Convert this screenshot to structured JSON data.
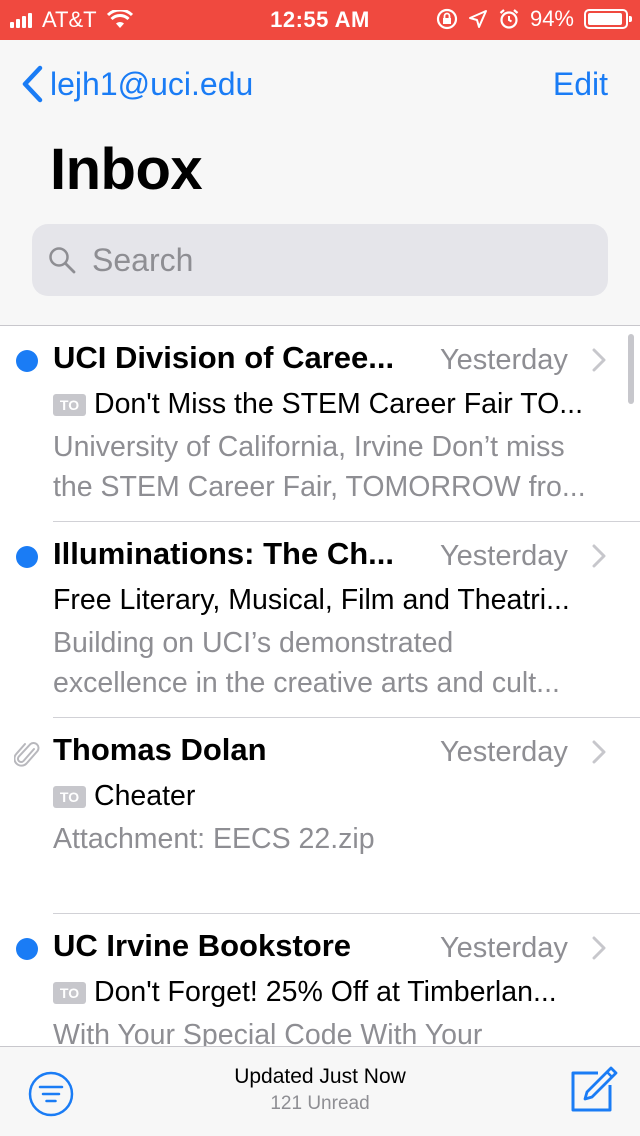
{
  "status_bar": {
    "carrier": "AT&T",
    "time": "12:55 AM",
    "battery_percent": "94%",
    "battery_level": 0.94,
    "icons": [
      "signal-bars-icon",
      "wifi-icon",
      "orientation-lock-icon",
      "location-arrow-icon",
      "alarm-clock-icon",
      "battery-icon"
    ]
  },
  "header": {
    "back_label": "lejh1@uci.edu",
    "edit_label": "Edit",
    "title": "Inbox",
    "search_placeholder": "Search"
  },
  "messages": [
    {
      "sender": "UCI Division of Caree...",
      "date": "Yesterday",
      "subject": "Don't Miss the STEM Career Fair TO...",
      "to_badge": "TO",
      "preview_line1": "University of California, Irvine Don’t miss",
      "preview_line2": "the STEM Career Fair, TOMORROW fro...",
      "unread": true,
      "attachment": false
    },
    {
      "sender": "Illuminations: The Ch...",
      "date": "Yesterday",
      "subject": "Free Literary, Musical, Film and Theatri...",
      "to_badge": "",
      "preview_line1": "Building on UCI’s demonstrated",
      "preview_line2": "excellence in the creative arts and cult...",
      "unread": true,
      "attachment": false
    },
    {
      "sender": "Thomas Dolan",
      "date": "Yesterday",
      "subject": "Cheater",
      "to_badge": "TO",
      "preview_line1": "Attachment: EECS 22.zip",
      "preview_line2": "",
      "unread": false,
      "attachment": true
    },
    {
      "sender": "UC Irvine Bookstore",
      "date": "Yesterday",
      "subject": "Don't Forget! 25% Off at Timberlan...",
      "to_badge": "TO",
      "preview_line1": "With Your Special Code With Your",
      "preview_line2": "",
      "unread": true,
      "attachment": false
    }
  ],
  "toolbar": {
    "updated_text": "Updated Just Now",
    "unread_text": "121 Unread"
  },
  "colors": {
    "status_bar_bg": "#f0493f",
    "accent": "#1a7cf5",
    "secondary_text": "#8e8e93"
  }
}
